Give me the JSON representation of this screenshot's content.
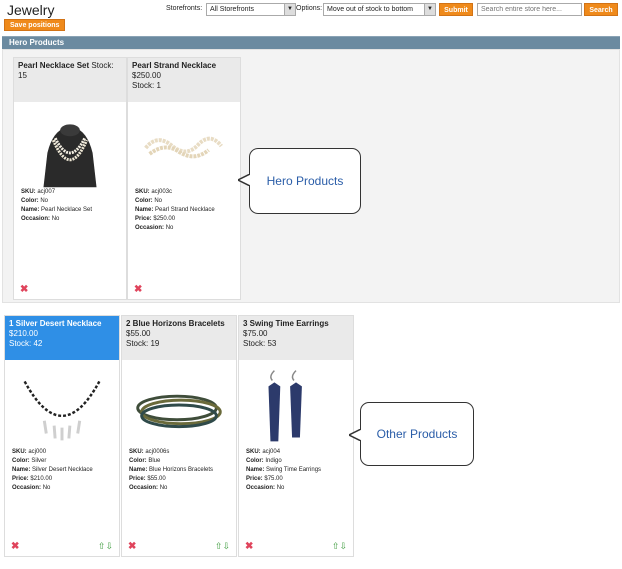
{
  "header": {
    "title": "Jewelry",
    "save_positions": "Save positions",
    "storefronts_label": "Storefronts:",
    "storefronts_value": "All Storefronts",
    "options_label": "Options:",
    "options_value": "Move out of stock to bottom",
    "submit": "Submit",
    "search_placeholder": "Search entire store here...",
    "search_button": "Search"
  },
  "section_title": "Hero Products",
  "hero_cards": [
    {
      "head_name": "Pearl Necklace Set",
      "head_line2": "Stock:",
      "head_line3": "15",
      "sku": "acj007",
      "color": "No",
      "name": "Pearl Necklace Set",
      "price": "",
      "occasion": "No",
      "image_icon": "pearl-necklace-bust-image"
    },
    {
      "head_name": "Pearl Strand Necklace",
      "head_line2": "$250.00",
      "head_line3": "Stock: 1",
      "sku": "acj003c",
      "color": "No",
      "name": "Pearl Strand Necklace",
      "price": "$250.00",
      "occasion": "No",
      "image_icon": "pearl-strand-image"
    }
  ],
  "other_cards": [
    {
      "head_name": "1 Silver Desert Necklace",
      "head_line2": "$210.00",
      "head_line3": "Stock: 42",
      "sku": "acj000",
      "color": "Silver",
      "name": "Silver Desert Necklace",
      "price": "$210.00",
      "occasion": "No",
      "image_icon": "silver-necklace-image"
    },
    {
      "head_name": "2 Blue Horizons Bracelets",
      "head_line2": "$55.00",
      "head_line3": "Stock: 19",
      "sku": "acj0006s",
      "color": "Blue",
      "name": "Blue Horizons Bracelets",
      "price": "$55.00",
      "occasion": "No",
      "image_icon": "bracelets-image"
    },
    {
      "head_name": "3 Swing Time Earrings",
      "head_line2": "$75.00",
      "head_line3": "Stock: 53",
      "sku": "acj004",
      "color": "Indigo",
      "name": "Swing Time Earrings",
      "price": "$75.00",
      "occasion": "No",
      "image_icon": "earrings-image"
    }
  ],
  "labels": {
    "sku": "SKU:",
    "color": "Color:",
    "name": "Name:",
    "price": "Price:",
    "occasion": "Occasion:"
  },
  "callouts": {
    "hero": "Hero Products",
    "other": "Other Products"
  },
  "colors": {
    "accent": "#ef8a1b",
    "section_bar": "#6b8aa0",
    "selected": "#2f8fe6",
    "delete": "#e0445c",
    "arrows": "#3c9b3c"
  }
}
